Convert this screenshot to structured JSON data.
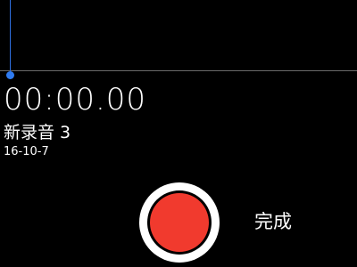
{
  "recorder": {
    "timer": "00:00.00",
    "title": "新录音 3",
    "date": "16-10-7"
  },
  "controls": {
    "record_icon": "record-dot-icon",
    "done_label": "完成"
  },
  "colors": {
    "background": "#000000",
    "playhead": "#2f7bf0",
    "record": "#f13a2e",
    "text": "#ffffff"
  }
}
